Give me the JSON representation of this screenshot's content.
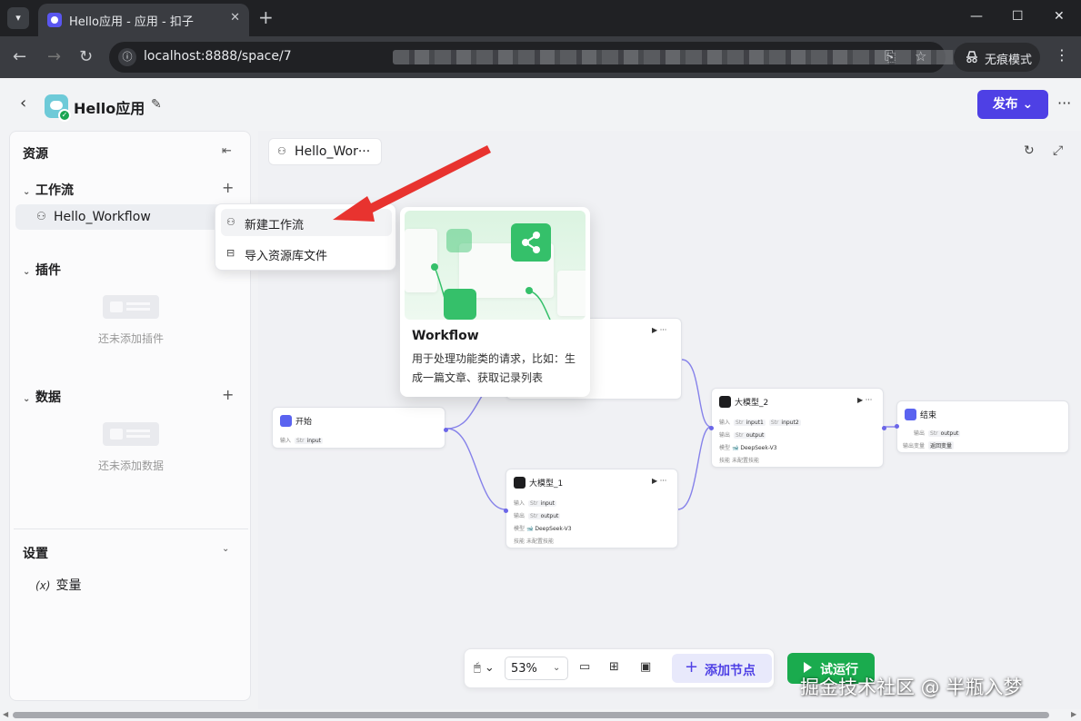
{
  "browser": {
    "tab_title": "Hello应用 - 应用 - 扣子",
    "url": "localhost:8888/space/7",
    "incognito_label": "无痕模式"
  },
  "app": {
    "name": "Hello应用",
    "publish_label": "发布"
  },
  "sidebar": {
    "title": "资源",
    "workflow_section": "工作流",
    "workflow_item": "Hello_Workflow",
    "plugin_section": "插件",
    "plugin_empty": "还未添加插件",
    "data_section": "数据",
    "data_empty": "还未添加数据",
    "settings_title": "设置",
    "variables_label": "变量",
    "variables_icon_text": "(x)"
  },
  "canvas": {
    "tab_label": "Hello_Wor···",
    "nodes": {
      "start": {
        "title": "开始",
        "input_label": "输入",
        "input_var": "input"
      },
      "llm1": {
        "title": "大模型_1",
        "in_label": "输入",
        "in_var": "input",
        "out_label": "输出",
        "out_var": "output",
        "model_label": "模型",
        "model_value": "DeepSeek-V3",
        "skill_label": "技能",
        "skill_value": "未配置技能"
      },
      "llm2": {
        "title": "大模型_2",
        "in_label": "输入",
        "in_var1": "input1",
        "in_var2": "input2",
        "out_label": "输出",
        "out_var": "output",
        "model_label": "模型",
        "model_value": "DeepSeek-V3",
        "skill_label": "技能",
        "skill_value": "未配置技能"
      },
      "end": {
        "title": "结束",
        "out_label": "输出",
        "out_var": "output",
        "output_var_label": "输出变量",
        "output_var_value": "返回变量"
      }
    }
  },
  "menu": {
    "new_workflow": "新建工作流",
    "import_file": "导入资源库文件"
  },
  "preview": {
    "title": "Workflow",
    "description": "用于处理功能类的请求，比如：生成一篇文章、获取记录列表"
  },
  "toolbar": {
    "zoom": "53%",
    "add_node": "添加节点",
    "run": "试运行"
  },
  "watermark": "掘金技术社区 @ 半瓶入梦",
  "icons": [
    "menu-icon",
    "close-icon",
    "plus-icon",
    "back-icon",
    "forward-icon",
    "reload-icon",
    "site-info-icon",
    "translate-icon",
    "star-icon",
    "incognito-icon",
    "edit-icon",
    "workflow-icon",
    "collapse-icon",
    "chevron-down-icon",
    "variable-icon",
    "refresh-icon",
    "fullscreen-icon",
    "mouse-icon",
    "comment-icon",
    "layout-icon",
    "minimap-icon",
    "play-icon"
  ],
  "colors": {
    "accent": "#4e40e5",
    "run": "#1aab4e",
    "edge": "#6b66e8"
  }
}
